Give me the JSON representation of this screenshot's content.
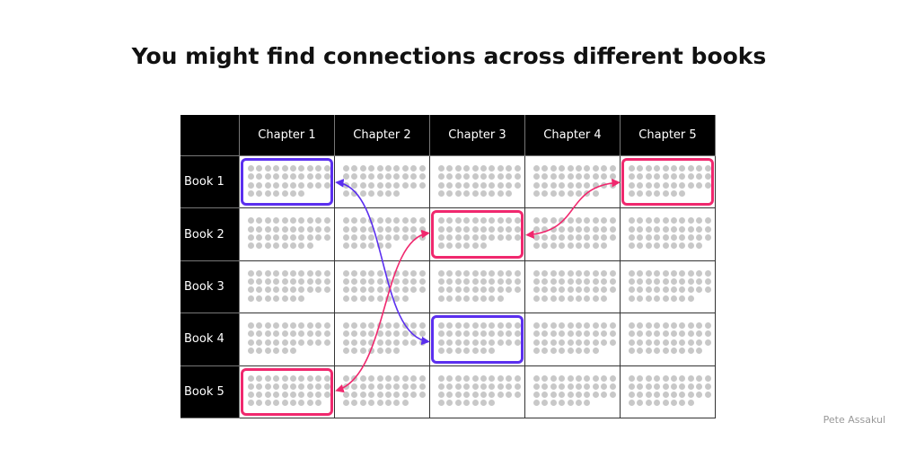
{
  "title": "You might find connections across different books",
  "credit": "Pete Assakul",
  "colors": {
    "purple": "#5b2fef",
    "pink": "#f0286e",
    "dot": "#c8c8c8"
  },
  "columns": [
    "Chapter 1",
    "Chapter 2",
    "Chapter 3",
    "Chapter 4",
    "Chapter 5"
  ],
  "rows": [
    {
      "label": "Book 1",
      "last_row_dots": [
        7,
        7,
        9,
        8,
        7
      ]
    },
    {
      "label": "Book 2",
      "last_row_dots": [
        8,
        6,
        6,
        9,
        9
      ]
    },
    {
      "label": "Book 3",
      "last_row_dots": [
        7,
        8,
        8,
        9,
        8
      ]
    },
    {
      "label": "Book 4",
      "last_row_dots": [
        6,
        7,
        7,
        8,
        9
      ]
    },
    {
      "label": "Book 5",
      "last_row_dots": [
        9,
        8,
        7,
        7,
        8
      ]
    }
  ],
  "dots_per_full_row": 10,
  "full_dot_rows": 3,
  "highlights": [
    {
      "book": 1,
      "chapter": 1,
      "color": "purple"
    },
    {
      "book": 4,
      "chapter": 3,
      "color": "purple"
    },
    {
      "book": 2,
      "chapter": 3,
      "color": "pink"
    },
    {
      "book": 1,
      "chapter": 5,
      "color": "pink"
    },
    {
      "book": 5,
      "chapter": 1,
      "color": "pink"
    }
  ],
  "connections": [
    {
      "from": {
        "book": 1,
        "chapter": 1
      },
      "to": {
        "book": 4,
        "chapter": 3
      },
      "color": "purple"
    },
    {
      "from": {
        "book": 5,
        "chapter": 1
      },
      "to": {
        "book": 2,
        "chapter": 3
      },
      "color": "pink"
    },
    {
      "from": {
        "book": 2,
        "chapter": 3
      },
      "to": {
        "book": 1,
        "chapter": 5
      },
      "color": "pink"
    }
  ]
}
